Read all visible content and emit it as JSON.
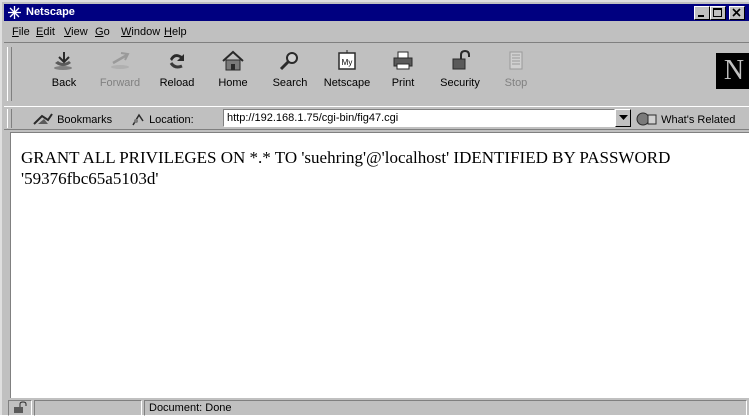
{
  "window": {
    "title": "Netscape"
  },
  "menu": [
    {
      "label": "File",
      "key": "F",
      "rest": "ile"
    },
    {
      "label": "Edit",
      "key": "E",
      "rest": "dit"
    },
    {
      "label": "View",
      "key": "V",
      "rest": "iew"
    },
    {
      "label": "Go",
      "key": "G",
      "rest": "o"
    },
    {
      "label": "Window",
      "key": "W",
      "rest": "indow"
    },
    {
      "label": "Help",
      "key": "H",
      "rest": "elp"
    }
  ],
  "toolbar": {
    "buttons": [
      {
        "label": "Back",
        "icon": "back-arrow-icon",
        "enabled": true
      },
      {
        "label": "Forward",
        "icon": "forward-arrow-icon",
        "enabled": false
      },
      {
        "label": "Reload",
        "icon": "reload-icon",
        "enabled": true
      },
      {
        "label": "Home",
        "icon": "home-icon",
        "enabled": true
      },
      {
        "label": "Search",
        "icon": "search-icon",
        "enabled": true
      },
      {
        "label": "Netscape",
        "icon": "my-netscape-icon",
        "enabled": true
      },
      {
        "label": "Print",
        "icon": "printer-icon",
        "enabled": true
      },
      {
        "label": "Security",
        "icon": "padlock-icon",
        "enabled": true
      },
      {
        "label": "Stop",
        "icon": "stop-icon",
        "enabled": false
      }
    ],
    "logo_letter": "N"
  },
  "location_bar": {
    "bookmarks_label": "Bookmarks",
    "location_label": "Location:",
    "url": "http://192.168.1.75/cgi-bin/fig47.cgi",
    "whats_related_label": "What's Related"
  },
  "page": {
    "text": "GRANT ALL PRIVILEGES ON *.* TO 'suehring'@'localhost' IDENTIFIED BY PASSWORD '59376fbc65a5103d'"
  },
  "status": {
    "text": "Document: Done"
  },
  "colors": {
    "titlebar": "#000080",
    "chrome": "#c0c0c0",
    "content_bg": "#ffffff"
  }
}
